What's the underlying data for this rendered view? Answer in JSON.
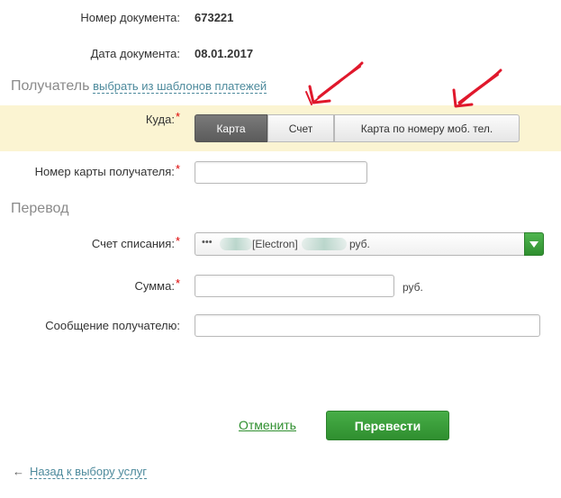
{
  "document": {
    "number_label": "Номер документа:",
    "number_value": "673221",
    "date_label": "Дата документа:",
    "date_value": "08.01.2017"
  },
  "recipient": {
    "section_title": "Получатель",
    "templates_link": "выбрать из шаблонов платежей",
    "where_label": "Куда:",
    "required_mark": "*",
    "options": [
      "Карта",
      "Счет",
      "Карта по номеру моб. тел."
    ],
    "selected_option": "Карта",
    "card_number_label": "Номер карты получателя:",
    "card_number_value": ""
  },
  "transfer": {
    "section_title": "Перевод",
    "account_label": "Счет списания:",
    "account_prefix": "•••",
    "account_type": "[Electron]",
    "account_currency": "руб.",
    "amount_label": "Сумма:",
    "amount_value": "",
    "amount_currency": "руб.",
    "message_label": "Сообщение получателю:",
    "message_value": ""
  },
  "actions": {
    "cancel_label": "Отменить",
    "submit_label": "Перевести",
    "back_arrow": "←",
    "back_label": "Назад к выбору услуг"
  },
  "colors": {
    "accent_green": "#2f8f2f",
    "link_blue": "#4d8a9c",
    "highlight_band": "#fbf4d2",
    "annotation_red": "#e0182c"
  },
  "icons": {
    "select_toggle": "chevron-down-icon",
    "back": "arrow-left-icon"
  }
}
